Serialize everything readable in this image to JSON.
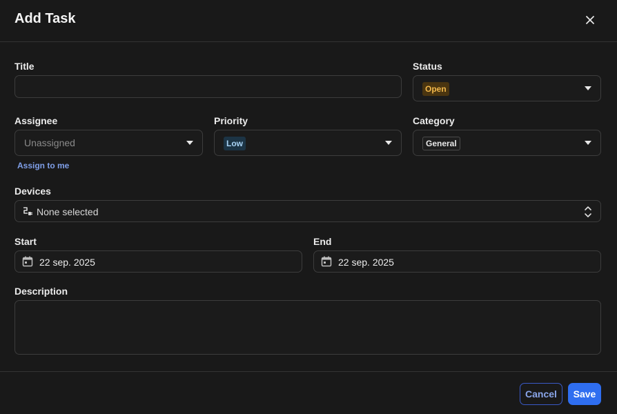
{
  "dialog": {
    "title": "Add Task"
  },
  "form": {
    "title_label": "Title",
    "title_value": "",
    "status_label": "Status",
    "status_value": "Open",
    "assignee_label": "Assignee",
    "assignee_placeholder": "Unassigned",
    "assign_to_me": "Assign to me",
    "priority_label": "Priority",
    "priority_value": "Low",
    "category_label": "Category",
    "category_value": "General",
    "devices_label": "Devices",
    "devices_value": "None selected",
    "start_label": "Start",
    "start_value": "22 sep. 2025",
    "end_label": "End",
    "end_value": "22 sep. 2025",
    "description_label": "Description",
    "description_value": ""
  },
  "footer": {
    "cancel_label": "Cancel",
    "save_label": "Save"
  },
  "colors": {
    "background": "#191919",
    "accent": "#2f6ef0",
    "status_open_bg": "#4a3510",
    "status_open_fg": "#f2b84b",
    "priority_low_bg": "#1c3445",
    "priority_low_fg": "#a9d4f5"
  },
  "icons": {
    "close": "close-icon",
    "dropdown": "chevron-down-icon",
    "devices": "device-plug-icon",
    "updown": "unfold-icon",
    "calendar": "calendar-icon"
  }
}
